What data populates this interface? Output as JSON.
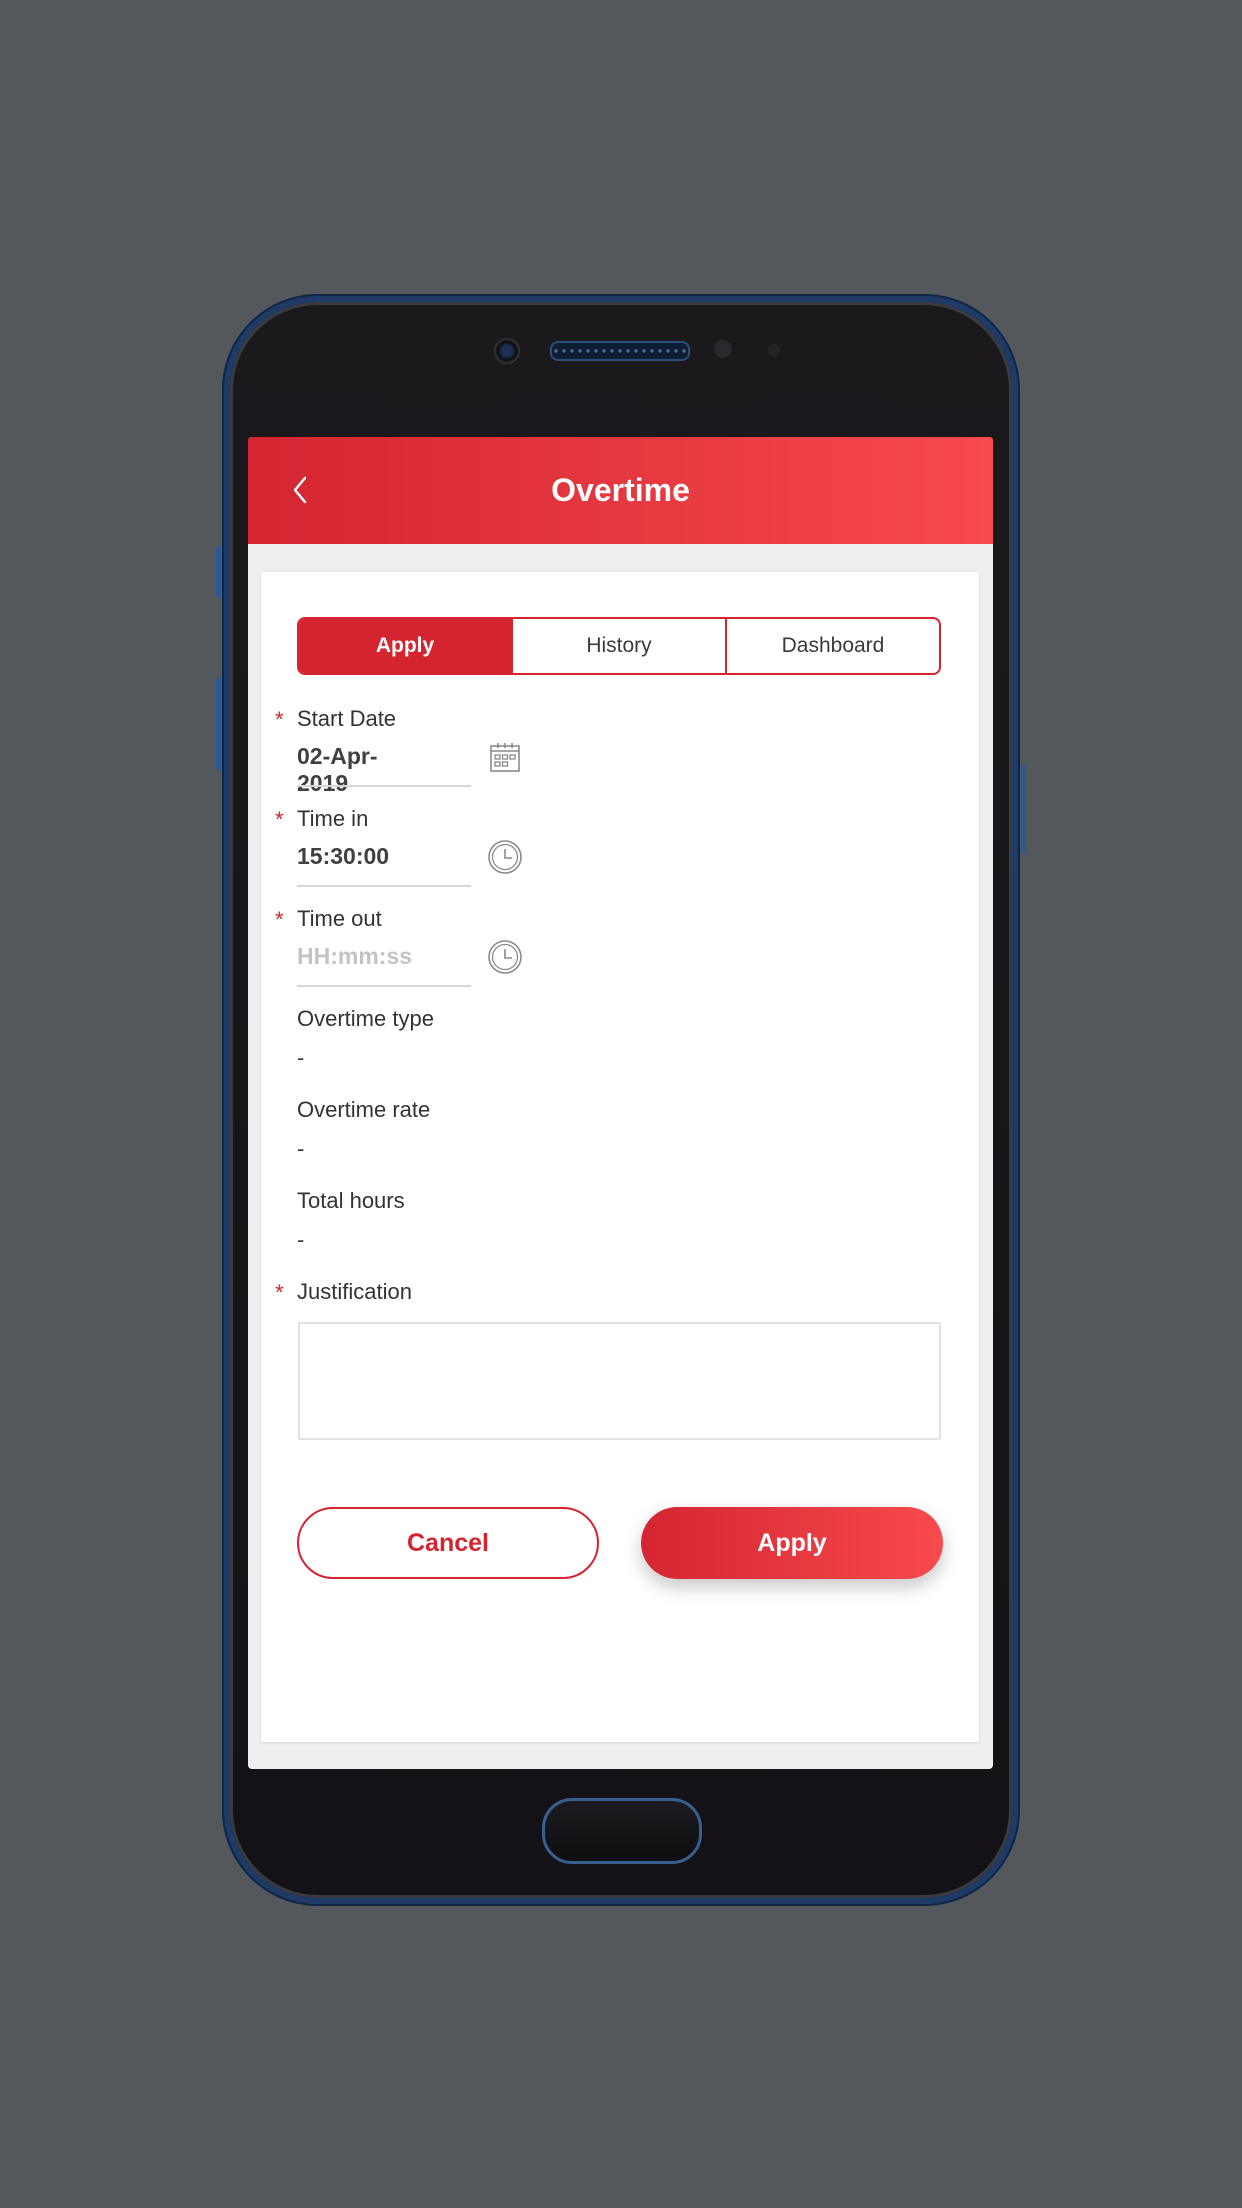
{
  "header": {
    "title": "Overtime",
    "back_icon": "chevron-left-icon"
  },
  "tabs": [
    {
      "label": "Apply",
      "active": true
    },
    {
      "label": "History",
      "active": false
    },
    {
      "label": "Dashboard",
      "active": false
    }
  ],
  "form": {
    "required_marker": "*",
    "start_date": {
      "label": "Start Date",
      "value": "02-Apr-2019",
      "icon": "calendar-icon",
      "required": true
    },
    "time_in": {
      "label": "Time in",
      "value": "15:30:00",
      "icon": "clock-icon",
      "required": true
    },
    "time_out": {
      "label": "Time out",
      "value": "",
      "placeholder": "HH:mm:ss",
      "icon": "clock-icon",
      "required": true
    },
    "overtime_type": {
      "label": "Overtime type",
      "value": "-"
    },
    "overtime_rate": {
      "label": "Overtime rate",
      "value": "-"
    },
    "total_hours": {
      "label": "Total hours",
      "value": "-"
    },
    "justification": {
      "label": "Justification",
      "value": "",
      "required": true
    }
  },
  "actions": {
    "cancel_label": "Cancel",
    "apply_label": "Apply"
  },
  "colors": {
    "brand_red": "#d32430",
    "brand_red_light": "#f74a4d",
    "text_dark": "#333333",
    "placeholder": "#c3c3c3"
  }
}
